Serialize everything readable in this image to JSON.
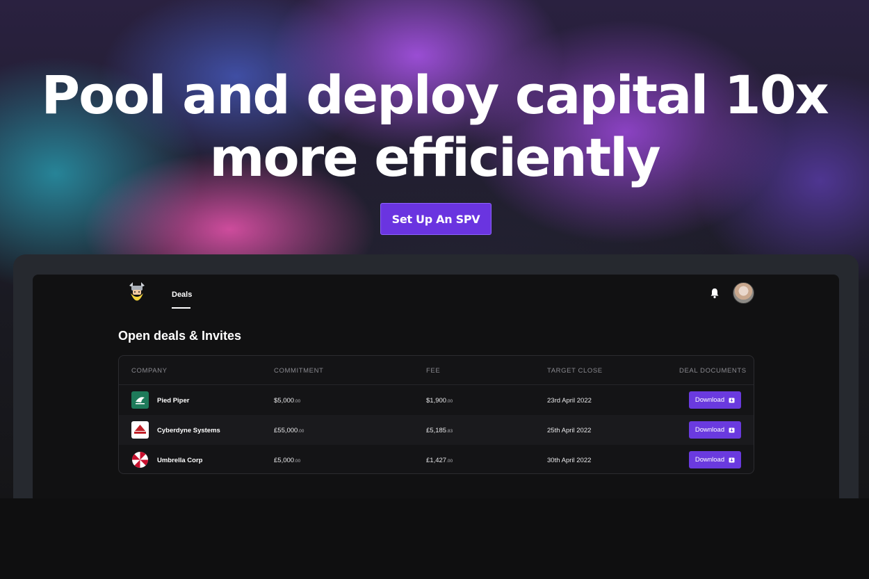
{
  "hero": {
    "headline_line1": "Pool and deploy capital 10x",
    "headline_line2": "more efficiently",
    "cta_label": "Set Up An SPV"
  },
  "app": {
    "nav_tab": "Deals",
    "section_title": "Open deals & Invites",
    "columns": [
      "COMPANY",
      "COMMITMENT",
      "FEE",
      "TARGET CLOSE",
      "DEAL DOCUMENTS"
    ],
    "rows": [
      {
        "company": "Pied Piper",
        "logo": "pied-piper-logo",
        "commitment": "$5,000",
        "commitment_cents": ".00",
        "fee": "$1,900",
        "fee_cents": ".00",
        "target_close": "23rd April 2022",
        "action": "Download"
      },
      {
        "company": "Cyberdyne Systems",
        "logo": "cyberdyne-logo",
        "commitment": "£55,000",
        "commitment_cents": ".00",
        "fee": "£5,185",
        "fee_cents": ".83",
        "target_close": "25th April 2022",
        "action": "Download"
      },
      {
        "company": "Umbrella Corp",
        "logo": "umbrella-logo",
        "commitment": "£5,000",
        "commitment_cents": ".00",
        "fee": "£1,427",
        "fee_cents": ".00",
        "target_close": "30th April 2022",
        "action": "Download"
      }
    ]
  },
  "icons": [
    "viking-logo-icon",
    "bell-icon",
    "avatar",
    "download-icon"
  ],
  "colors": {
    "accent": "#6a3adf",
    "cta": "#6a34e0",
    "pied_piper_green": "#1e7a5a",
    "cyberdyne_red": "#c02028",
    "umbrella_red": "#c8102e"
  }
}
